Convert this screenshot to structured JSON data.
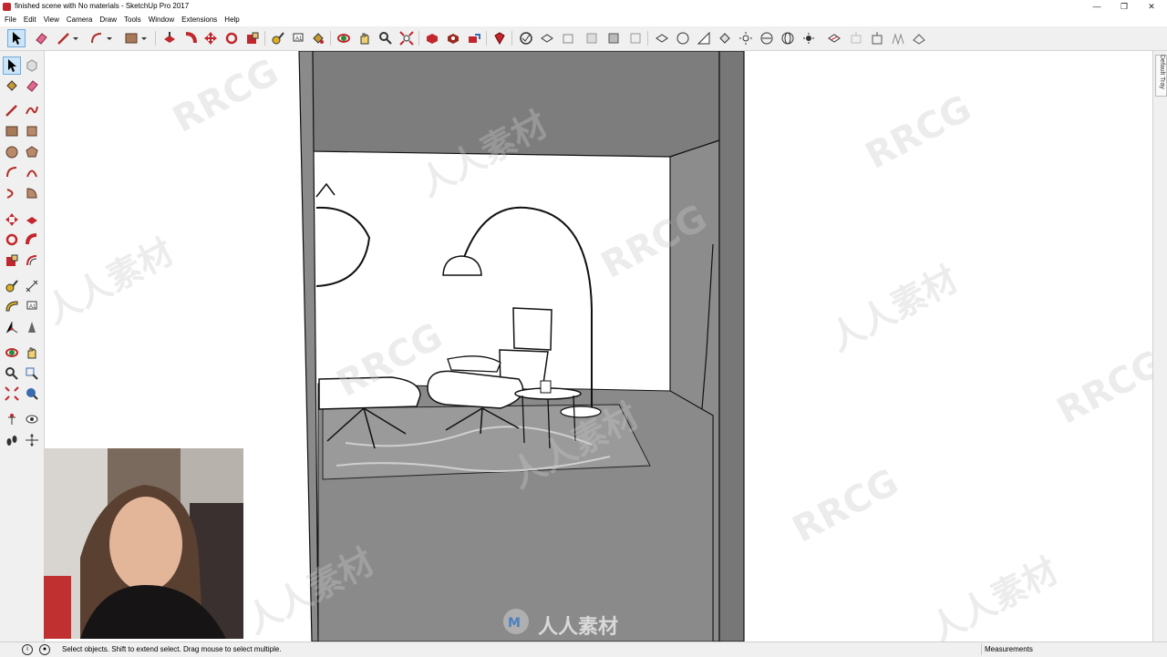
{
  "window": {
    "title": "finished scene with No materials - SketchUp Pro 2017",
    "controls": {
      "minimize": "—",
      "restore": "❐",
      "close": "✕"
    }
  },
  "menu": [
    "File",
    "Edit",
    "View",
    "Camera",
    "Draw",
    "Tools",
    "Window",
    "Extensions",
    "Help"
  ],
  "tray": {
    "label": "Default Tray"
  },
  "status": {
    "text": "Select objects. Shift to extend select. Drag mouse to select multiple.",
    "info_icon": "i",
    "user_icon": "●",
    "measurements_label": "Measurements"
  },
  "watermark": {
    "text": "RRCG",
    "cn": "人人素材",
    "logo_text": "人人素材"
  },
  "colors": {
    "accent": "#c1272d",
    "select_highlight": "#cce4f7",
    "wall_gray": "#7d7d7d",
    "floor_gray": "#8a8a8a"
  }
}
